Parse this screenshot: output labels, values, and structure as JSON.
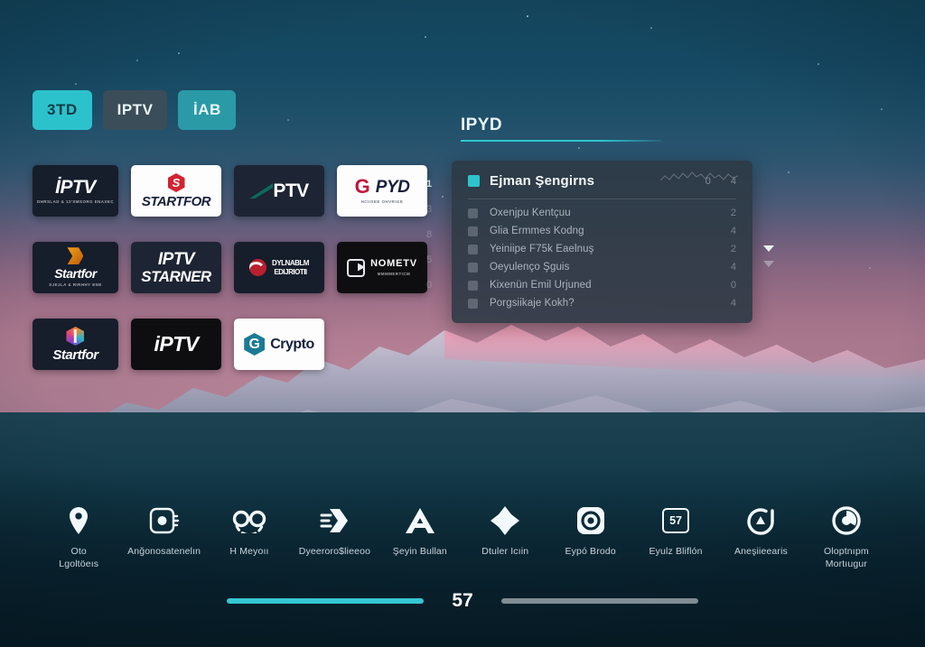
{
  "tabs": [
    {
      "label": "3TD",
      "state": "active"
    },
    {
      "label": "IPTV",
      "state": "default"
    },
    {
      "label": "İAB",
      "state": "alt"
    }
  ],
  "logo_grid": {
    "rows": [
      [
        {
          "name": "iptv-dark-card",
          "main": "İPTV",
          "sub": "DHRSLAD & 12'SMSORG ENAXEC"
        },
        {
          "name": "startfor-card",
          "main": "STARTFOR",
          "sub": ""
        },
        {
          "name": "ptv-card",
          "main": "PTV",
          "sub": ""
        },
        {
          "name": "gpyd-card",
          "main": "PYD",
          "sub": "HCIISEE OHVRIGE"
        }
      ],
      [
        {
          "name": "startfor-gold-card",
          "main": "Startfor",
          "sub": "SJEJLA & RIRHHY ENE"
        },
        {
          "name": "iptv-starner-card",
          "main": "IPTV",
          "sub": "STARNER"
        },
        {
          "name": "dylnablm-card",
          "main": "DYLNABLM",
          "sub": "EDIJRIOTII"
        },
        {
          "name": "nometv-card",
          "main": "NOMETV",
          "sub": "MMMMERTICM"
        }
      ],
      [
        {
          "name": "startfor-prism-card",
          "main": "Startfor",
          "sub": ""
        },
        {
          "name": "iptv-black-card",
          "main": "iPTV",
          "sub": ""
        },
        {
          "name": "crypto-card",
          "main": "Crypto",
          "sub": ""
        }
      ]
    ]
  },
  "axis_numbers": [
    "1",
    "3",
    "8",
    "5",
    "0"
  ],
  "panel": {
    "title": "IPYD",
    "header": {
      "label": "Ejman Şengirns",
      "num_left": "0",
      "num_right": "4"
    },
    "rows": [
      {
        "label": "Oxenjpu Kentçuu",
        "value": "2"
      },
      {
        "label": "Glia Ermmes Kodng",
        "value": "4"
      },
      {
        "label": "Yeiniipe F75k Eaelnuş",
        "value": "2"
      },
      {
        "label": "Oeyulenço Şguis",
        "value": "4"
      },
      {
        "label": "Kixenün Emil Urjuned",
        "value": "0"
      },
      {
        "label": "Porgsiikaje Kokh?",
        "value": "4"
      }
    ]
  },
  "navbar": {
    "items": [
      {
        "icon": "location-pin-icon",
        "label": "Oto\nLgoltöeıs"
      },
      {
        "icon": "device-chip-icon",
        "label": "Anğonosatenelın"
      },
      {
        "icon": "double-circle-icon",
        "label": "H Meyoıı"
      },
      {
        "icon": "chevron-box-icon",
        "label": "Dyeeroro$lieeoo"
      },
      {
        "icon": "triangle-a-icon",
        "label": "Şeyin Bullan"
      },
      {
        "icon": "compass-star-icon",
        "label": "Dtuler Icıin"
      },
      {
        "icon": "target-square-icon",
        "label": "Eypó Brodo"
      },
      {
        "icon": "number-badge-icon",
        "label": "Eyulz Bliflón",
        "badge": "57"
      },
      {
        "icon": "clock-dial-icon",
        "label": "Aneşiieearis"
      },
      {
        "icon": "pie-ring-icon",
        "label": "Oloptnıpm\nMortıugur"
      }
    ]
  },
  "progress": {
    "value": "57",
    "left_bar_label": "playback-progress",
    "right_bar_label": "volume-progress"
  },
  "colors": {
    "accent": "#2cc2cc",
    "accent_alt": "#2a9aa7",
    "panel_bg": "#2d3a45",
    "text_primary": "#eaf4f8"
  }
}
